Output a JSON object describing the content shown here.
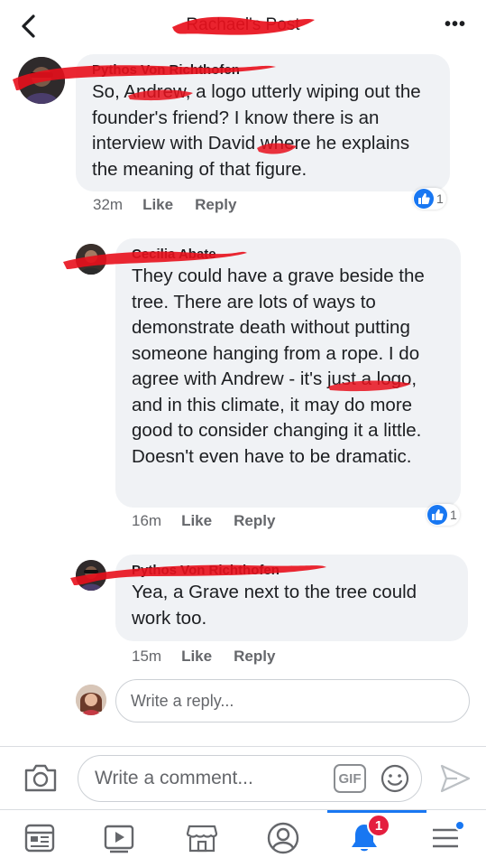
{
  "header": {
    "title": "Rachael's Post",
    "back_icon": "chevron-left-icon",
    "more_label": "•••"
  },
  "comments": [
    {
      "author": "Pythos Von Richthofen",
      "text": "So, Andrew, a logo utterly wiping out the founder's friend?  I know there is an interview with David where he explains the meaning of that figure.",
      "time": "32m",
      "like_label": "Like",
      "reply_label": "Reply",
      "reaction_count": "1",
      "reaction_icon": "like-thumb-icon"
    },
    {
      "author": "Cecilia Abate",
      "text": "They could have a grave beside the tree. There are lots of ways to demonstrate death without putting someone hanging from a rope. I do agree with Andrew - it's just a logo, and in this climate, it may do more good to consider changing it a little. Doesn't even have to be dramatic.",
      "time": "16m",
      "like_label": "Like",
      "reply_label": "Reply",
      "reaction_count": "1",
      "reaction_icon": "like-thumb-icon"
    },
    {
      "author": "Pythos Von Richthofen",
      "text": "Yea, a Grave next to the tree could work too.",
      "time": "15m",
      "like_label": "Like",
      "reply_label": "Reply"
    }
  ],
  "reply_input": {
    "placeholder": "Write a reply..."
  },
  "composer": {
    "placeholder": "Write a comment...",
    "gif_label": "GIF",
    "camera_icon": "camera-icon",
    "emoji_icon": "emoji-icon",
    "send_icon": "send-icon"
  },
  "tabbar": {
    "tabs": [
      "news-feed-icon",
      "watch-icon",
      "marketplace-icon",
      "profile-icon",
      "notifications-icon",
      "menu-icon"
    ],
    "notification_count": "1"
  },
  "colors": {
    "accent": "#1877f2",
    "badge": "#e41e3f",
    "bubble": "#f0f2f5",
    "redaction": "#e8101c"
  }
}
